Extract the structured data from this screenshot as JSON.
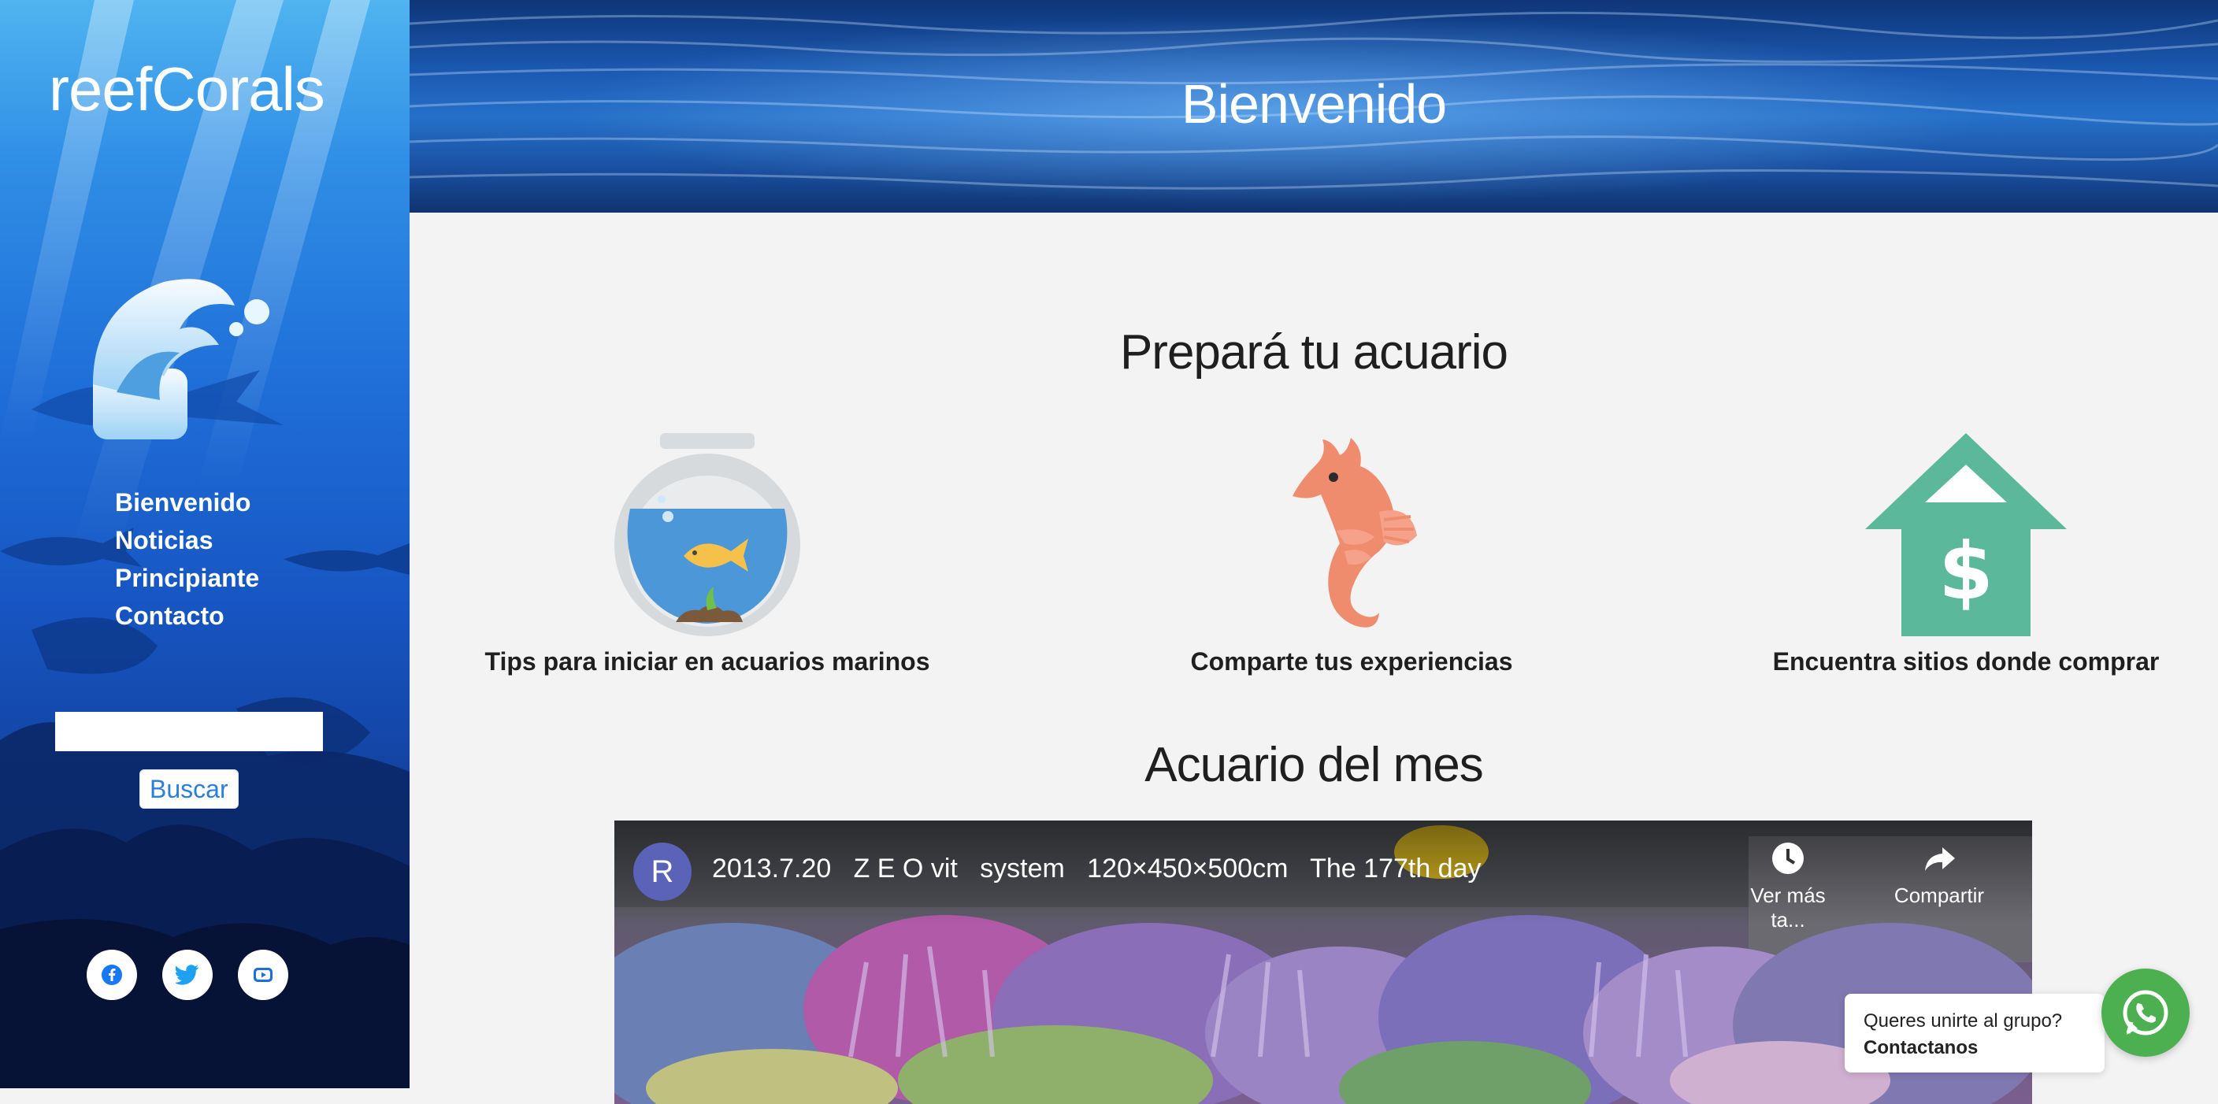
{
  "sidebar": {
    "logo": "reefCorals",
    "nav": [
      {
        "label": "Bienvenido"
      },
      {
        "label": "Noticias"
      },
      {
        "label": "Principiante"
      },
      {
        "label": "Contacto"
      }
    ],
    "search": {
      "value": "",
      "placeholder": "",
      "button_label": "Buscar"
    },
    "socials": [
      {
        "icon": "facebook-icon"
      },
      {
        "icon": "twitter-icon"
      },
      {
        "icon": "youtube-icon"
      }
    ]
  },
  "hero": {
    "title": "Bienvenido"
  },
  "prepare": {
    "title": "Prepará tu acuario",
    "cards": [
      {
        "icon": "fishbowl-icon",
        "caption": "Tips para iniciar en acuarios marinos"
      },
      {
        "icon": "seahorse-icon",
        "caption": "Comparte tus experiencias"
      },
      {
        "icon": "shop-price-icon",
        "caption": "Encuentra sitios donde comprar"
      }
    ]
  },
  "month": {
    "title": "Acuario del mes",
    "video": {
      "channel_initial": "R",
      "title": "2013.7.20   Z E O vit   system   120×450×500cm   The 177th day",
      "watch_later": "Ver más ta...",
      "share": "Compartir"
    }
  },
  "whatsapp": {
    "line1": "Queres unirte al grupo?",
    "line2": "Contactanos"
  },
  "colors": {
    "accent_green": "#5cb89a",
    "whatsapp": "#4caf50",
    "link_blue": "#2a7fd8"
  }
}
